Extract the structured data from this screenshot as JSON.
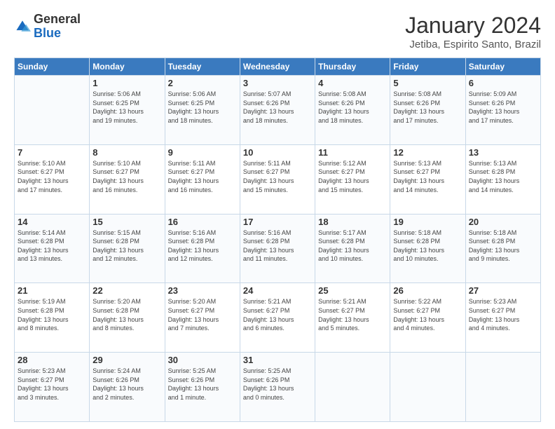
{
  "header": {
    "logo_general": "General",
    "logo_blue": "Blue",
    "month_title": "January 2024",
    "subtitle": "Jetiba, Espirito Santo, Brazil"
  },
  "calendar": {
    "days_of_week": [
      "Sunday",
      "Monday",
      "Tuesday",
      "Wednesday",
      "Thursday",
      "Friday",
      "Saturday"
    ],
    "weeks": [
      [
        {
          "day": "",
          "info": ""
        },
        {
          "day": "1",
          "info": "Sunrise: 5:06 AM\nSunset: 6:25 PM\nDaylight: 13 hours\nand 19 minutes."
        },
        {
          "day": "2",
          "info": "Sunrise: 5:06 AM\nSunset: 6:25 PM\nDaylight: 13 hours\nand 18 minutes."
        },
        {
          "day": "3",
          "info": "Sunrise: 5:07 AM\nSunset: 6:26 PM\nDaylight: 13 hours\nand 18 minutes."
        },
        {
          "day": "4",
          "info": "Sunrise: 5:08 AM\nSunset: 6:26 PM\nDaylight: 13 hours\nand 18 minutes."
        },
        {
          "day": "5",
          "info": "Sunrise: 5:08 AM\nSunset: 6:26 PM\nDaylight: 13 hours\nand 17 minutes."
        },
        {
          "day": "6",
          "info": "Sunrise: 5:09 AM\nSunset: 6:26 PM\nDaylight: 13 hours\nand 17 minutes."
        }
      ],
      [
        {
          "day": "7",
          "info": "Sunrise: 5:10 AM\nSunset: 6:27 PM\nDaylight: 13 hours\nand 17 minutes."
        },
        {
          "day": "8",
          "info": "Sunrise: 5:10 AM\nSunset: 6:27 PM\nDaylight: 13 hours\nand 16 minutes."
        },
        {
          "day": "9",
          "info": "Sunrise: 5:11 AM\nSunset: 6:27 PM\nDaylight: 13 hours\nand 16 minutes."
        },
        {
          "day": "10",
          "info": "Sunrise: 5:11 AM\nSunset: 6:27 PM\nDaylight: 13 hours\nand 15 minutes."
        },
        {
          "day": "11",
          "info": "Sunrise: 5:12 AM\nSunset: 6:27 PM\nDaylight: 13 hours\nand 15 minutes."
        },
        {
          "day": "12",
          "info": "Sunrise: 5:13 AM\nSunset: 6:27 PM\nDaylight: 13 hours\nand 14 minutes."
        },
        {
          "day": "13",
          "info": "Sunrise: 5:13 AM\nSunset: 6:28 PM\nDaylight: 13 hours\nand 14 minutes."
        }
      ],
      [
        {
          "day": "14",
          "info": "Sunrise: 5:14 AM\nSunset: 6:28 PM\nDaylight: 13 hours\nand 13 minutes."
        },
        {
          "day": "15",
          "info": "Sunrise: 5:15 AM\nSunset: 6:28 PM\nDaylight: 13 hours\nand 12 minutes."
        },
        {
          "day": "16",
          "info": "Sunrise: 5:16 AM\nSunset: 6:28 PM\nDaylight: 13 hours\nand 12 minutes."
        },
        {
          "day": "17",
          "info": "Sunrise: 5:16 AM\nSunset: 6:28 PM\nDaylight: 13 hours\nand 11 minutes."
        },
        {
          "day": "18",
          "info": "Sunrise: 5:17 AM\nSunset: 6:28 PM\nDaylight: 13 hours\nand 10 minutes."
        },
        {
          "day": "19",
          "info": "Sunrise: 5:18 AM\nSunset: 6:28 PM\nDaylight: 13 hours\nand 10 minutes."
        },
        {
          "day": "20",
          "info": "Sunrise: 5:18 AM\nSunset: 6:28 PM\nDaylight: 13 hours\nand 9 minutes."
        }
      ],
      [
        {
          "day": "21",
          "info": "Sunrise: 5:19 AM\nSunset: 6:28 PM\nDaylight: 13 hours\nand 8 minutes."
        },
        {
          "day": "22",
          "info": "Sunrise: 5:20 AM\nSunset: 6:28 PM\nDaylight: 13 hours\nand 8 minutes."
        },
        {
          "day": "23",
          "info": "Sunrise: 5:20 AM\nSunset: 6:27 PM\nDaylight: 13 hours\nand 7 minutes."
        },
        {
          "day": "24",
          "info": "Sunrise: 5:21 AM\nSunset: 6:27 PM\nDaylight: 13 hours\nand 6 minutes."
        },
        {
          "day": "25",
          "info": "Sunrise: 5:21 AM\nSunset: 6:27 PM\nDaylight: 13 hours\nand 5 minutes."
        },
        {
          "day": "26",
          "info": "Sunrise: 5:22 AM\nSunset: 6:27 PM\nDaylight: 13 hours\nand 4 minutes."
        },
        {
          "day": "27",
          "info": "Sunrise: 5:23 AM\nSunset: 6:27 PM\nDaylight: 13 hours\nand 4 minutes."
        }
      ],
      [
        {
          "day": "28",
          "info": "Sunrise: 5:23 AM\nSunset: 6:27 PM\nDaylight: 13 hours\nand 3 minutes."
        },
        {
          "day": "29",
          "info": "Sunrise: 5:24 AM\nSunset: 6:26 PM\nDaylight: 13 hours\nand 2 minutes."
        },
        {
          "day": "30",
          "info": "Sunrise: 5:25 AM\nSunset: 6:26 PM\nDaylight: 13 hours\nand 1 minute."
        },
        {
          "day": "31",
          "info": "Sunrise: 5:25 AM\nSunset: 6:26 PM\nDaylight: 13 hours\nand 0 minutes."
        },
        {
          "day": "",
          "info": ""
        },
        {
          "day": "",
          "info": ""
        },
        {
          "day": "",
          "info": ""
        }
      ]
    ]
  }
}
